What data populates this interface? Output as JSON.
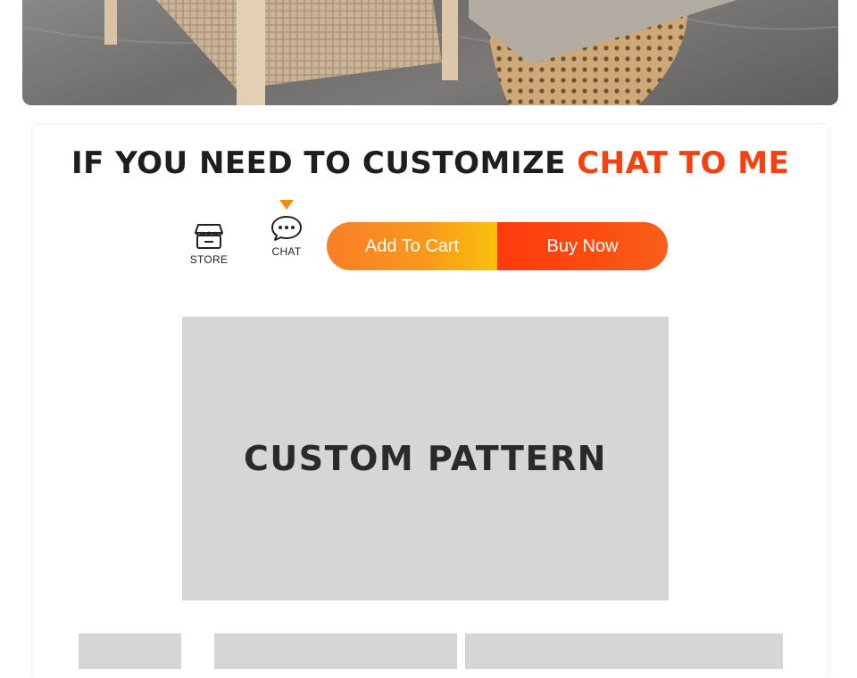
{
  "banner": {
    "image_alt": "rattan chair and table product photo"
  },
  "headline": {
    "main": "IF YOU NEED TO CUSTOMIZE",
    "accent": "CHAT TO ME",
    "accent_color": "#f4410f"
  },
  "store": {
    "label": "STORE",
    "icon": "store-icon"
  },
  "chat": {
    "label": "CHAT",
    "icon": "chat-bubble-icon",
    "pointer_color": "#f58a17"
  },
  "buttons": {
    "add_to_cart": "Add To Cart",
    "buy_now": "Buy Now"
  },
  "pattern": {
    "label": "CUSTOM PATTERN"
  }
}
